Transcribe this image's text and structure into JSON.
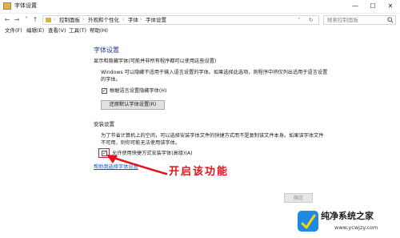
{
  "window": {
    "title": "字体设置",
    "minimize_glyph": "—",
    "maximize_glyph": "☐",
    "close_glyph": "✕"
  },
  "nav": {
    "back_glyph": "←",
    "forward_glyph": "→",
    "recent_glyph": "˅",
    "up_glyph": "↑",
    "refresh_glyph": "↻",
    "dropdown_glyph": "˅"
  },
  "breadcrumb": {
    "separator": "›",
    "items": [
      "控制面板",
      "外观和个性化",
      "字体",
      "字体设置"
    ]
  },
  "search": {
    "placeholder": "搜索控制面板"
  },
  "menu": {
    "items": [
      "文件(F)",
      "编辑(E)",
      "查看(V)",
      "工具(T)",
      "帮助(H)"
    ]
  },
  "section1": {
    "title": "字体设置",
    "subtitle": "显示和隐藏字体(可能并非所有程序都可以使用这些设置)",
    "desc_line1": "Windows 可以隐藏不适用于输入语言设置的字体。如果选择此选项，则程序中将仅列出适用于语言设置",
    "desc_line2": "的字体。",
    "checkbox_label": "根据语言设置隐藏字体(H)",
    "checkbox_checked": true,
    "restore_button": "还原默认字体设置(R)"
  },
  "section2": {
    "title": "安装设置",
    "desc_line1": "为了节省计算机上的空间，可以选择安装字体文件的快捷方式而不是复制该文件本身。如果该字体文件",
    "desc_line2": "不可用，则你可能无法使用该字体。",
    "checkbox_label": "允许使用快捷方式安装字体(高级)(A)",
    "checkbox_checked": true
  },
  "help_link": "帮助我选择字体设置",
  "annotation": "开启该功能",
  "ok_button": "确定",
  "watermark": {
    "title": "纯净系统之家",
    "url": "www.ycwjzy.com"
  },
  "colors": {
    "accent_red": "#e5121c",
    "link_blue": "#0b57d0",
    "heading_blue": "#1e3a8a"
  }
}
